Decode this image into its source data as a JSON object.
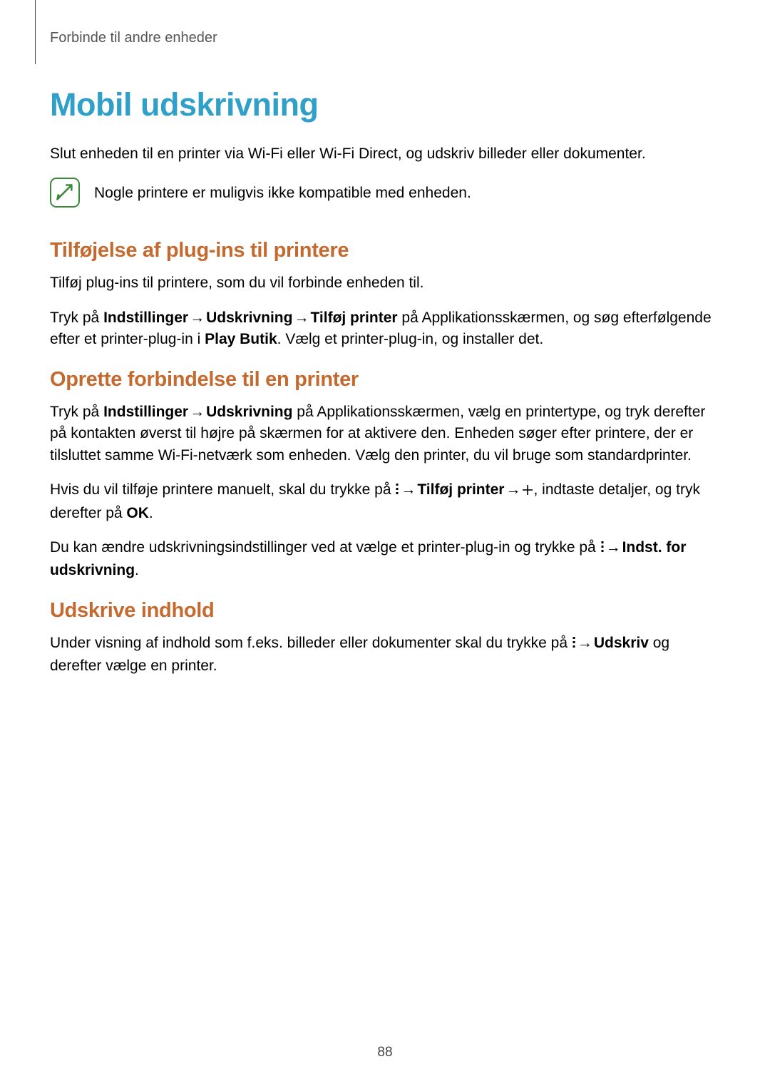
{
  "breadcrumb": "Forbinde til andre enheder",
  "title": "Mobil udskrivning",
  "intro": "Slut enheden til en printer via Wi-Fi eller Wi-Fi Direct, og udskriv billeder eller dokumenter.",
  "note": "Nogle printere er muligvis ikke kompatible med enheden.",
  "s1": {
    "heading": "Tilføjelse af plug-ins til printere",
    "p1": "Tilføj plug-ins til printere, som du vil forbinde enheden til.",
    "p2a": "Tryk på ",
    "p2b": "Indstillinger",
    "p2c": "Udskrivning",
    "p2d": "Tilføj printer",
    "p2e": " på Applikationsskærmen, og søg efterfølgende efter et printer-plug-in i ",
    "p2f": "Play Butik",
    "p2g": ". Vælg et printer-plug-in, og installer det."
  },
  "s2": {
    "heading": "Oprette forbindelse til en printer",
    "p1a": "Tryk på ",
    "p1b": "Indstillinger",
    "p1c": "Udskrivning",
    "p1d": " på Applikationsskærmen, vælg en printertype, og tryk derefter på kontakten øverst til højre på skærmen for at aktivere den. Enheden søger efter printere, der er tilsluttet samme Wi-Fi-netværk som enheden. Vælg den printer, du vil bruge som standardprinter.",
    "p2a": "Hvis du vil tilføje printere manuelt, skal du trykke på ",
    "p2b": "Tilføj printer",
    "p2c": ", indtaste detaljer, og tryk derefter på ",
    "p2d": "OK",
    "p2e": ".",
    "p3a": "Du kan ændre udskrivningsindstillinger ved at vælge et printer-plug-in og trykke på ",
    "p3b": "Indst. for udskrivning",
    "p3c": "."
  },
  "s3": {
    "heading": "Udskrive indhold",
    "p1a": "Under visning af indhold som f.eks. billeder eller dokumenter skal du trykke på ",
    "p1b": "Udskriv",
    "p1c": " og derefter vælge en printer."
  },
  "arrow": "→",
  "page_number": "88"
}
